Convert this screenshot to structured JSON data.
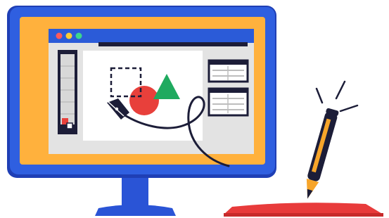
{
  "illustration": {
    "subject": "graphic-design-workstation",
    "icons": {
      "monitor": "monitor-icon",
      "app_window": "app-window-icon",
      "window_controls": [
        "close-dot-icon",
        "minimize-dot-icon",
        "maximize-dot-icon"
      ],
      "tool_panel": "tool-panel-icon",
      "canvas": "canvas-icon",
      "selection_box": "selection-box-icon",
      "circle_shape": "circle-shape-icon",
      "triangle_shape": "triangle-shape-icon",
      "pen_tool": "pen-tool-icon",
      "bezier_curve": "bezier-curve-icon",
      "properties_panels": [
        "properties-panel-icon",
        "properties-panel-icon"
      ],
      "stylus": "stylus-icon",
      "drawing_tablet": "drawing-tablet-icon",
      "spark_lines": "spark-lines-icon"
    },
    "colors": {
      "monitor_blue": "#2f5fe0",
      "monitor_shadow": "#1f3fb5",
      "bezel_orange": "#ffb13d",
      "window_gray": "#e3e3e3",
      "canvas_white": "#ffffff",
      "toolbar_blue": "#2b5bd8",
      "dark_navy": "#1c1d38",
      "shape_red": "#e8403b",
      "shape_green": "#1faa5f",
      "stylus_orange": "#f7a52a",
      "tablet_red": "#e83b3b",
      "stand_blue": "#2a54d6",
      "dot_red": "#ff5a5a",
      "dot_yellow": "#ffcc33",
      "dot_green": "#3dd68c"
    }
  }
}
